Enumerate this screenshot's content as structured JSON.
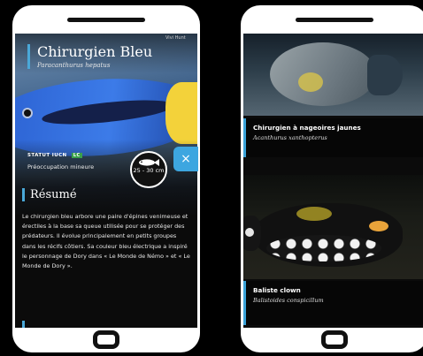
{
  "left_screen": {
    "corner_text": "Vivi Hunt",
    "title": "Chirurgien Bleu",
    "scientific_name": "Paracanthurus hepatus",
    "status_label": "STATUT IUCN",
    "status_code": "LC",
    "status_value": "Préoccupation mineure",
    "size_text": "25 - 30 cm",
    "size_icon": "fish-icon",
    "close_label": "×",
    "section_title": "Résumé",
    "summary": "Le chirurgien bleu arbore une paire d'épines venimeuse et érectiles à la base sa queue utilisée pour se protéger des prédateurs. Il évolue principalement en petits groupes dans les récifs côtiers. Sa couleur bleu électrique a inspiré le personnage de Dory dans « Le Monde de Némo » et « Le Monde de Dory »."
  },
  "right_screen": {
    "cards": [
      {
        "name": "Chirurgien à nageoires jaunes",
        "scientific_name": "Acanthurus xanthopterus"
      },
      {
        "name": "Baliste clown",
        "scientific_name": "Balistoides conspicillum"
      }
    ]
  },
  "colors": {
    "accent": "#3da6e0",
    "status_green": "#3aa04a",
    "background": "#000000"
  }
}
